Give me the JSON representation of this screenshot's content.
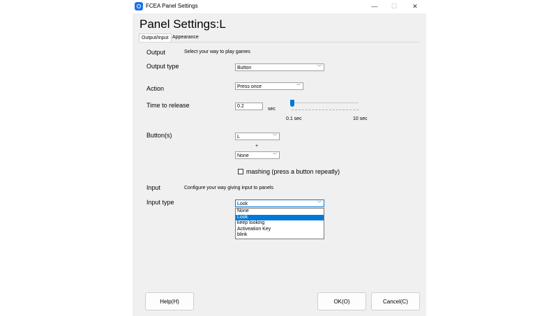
{
  "window": {
    "title": "FCEA Panel Settings",
    "controls": {
      "minimize": "—",
      "maximize": "☐",
      "close": "✕"
    }
  },
  "page_title": "Panel Settings:L",
  "tabs": [
    {
      "label": "Output/Input",
      "active": true
    },
    {
      "label": "Appearance",
      "active": false
    }
  ],
  "output": {
    "heading": "Output",
    "description": "Select your way to play games",
    "output_type_label": "Output type",
    "output_type_value": "Button",
    "action_label": "Action",
    "action_value": "Press once",
    "time_label": "Time to release",
    "time_value": "0.2",
    "time_unit": "sec",
    "slider_min_label": "0.1 sec",
    "slider_max_label": "10 sec",
    "slider_value_fraction": 0.01,
    "buttons_label": "Button(s)",
    "button1_value": "L",
    "plus": "+",
    "button2_value": "None",
    "mashing_label": "mashing (press a button repeatly)",
    "mashing_checked": false
  },
  "input": {
    "heading": "Input",
    "description": "Configure your way giving input to panels",
    "input_type_label": "Input type",
    "input_type_value": "Look",
    "options": [
      "None",
      "Look",
      "keep looking",
      "Activeation Key",
      "blink"
    ],
    "selected_index": 1
  },
  "footer": {
    "help": "Help(H)",
    "ok": "OK(O)",
    "cancel": "Cancel(C)"
  },
  "colors": {
    "accent": "#0078d7",
    "window_bg": "#f0f0f0"
  }
}
